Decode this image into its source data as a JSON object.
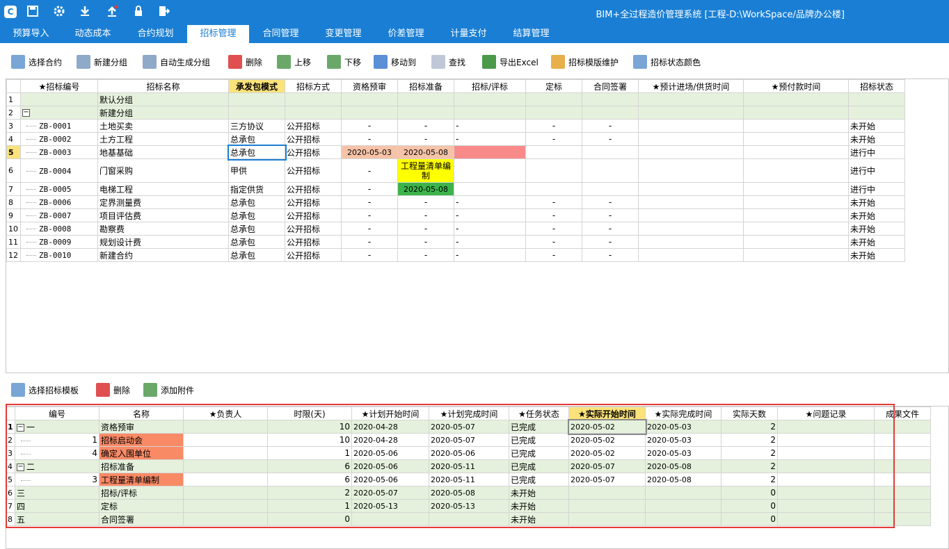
{
  "app": {
    "title": "BIM+全过程造价管理系统 [工程-D:\\WorkSpace/品牌办公楼]"
  },
  "quick_icons": [
    "logo-icon",
    "save-icon",
    "gear-icon",
    "download-icon",
    "upload-icon",
    "lock-icon",
    "exit-icon"
  ],
  "tabs": [
    {
      "label": "预算导入"
    },
    {
      "label": "动态成本"
    },
    {
      "label": "合约规划"
    },
    {
      "label": "招标管理",
      "active": true
    },
    {
      "label": "合同管理"
    },
    {
      "label": "变更管理"
    },
    {
      "label": "价差管理"
    },
    {
      "label": "计量支付"
    },
    {
      "label": "结算管理"
    }
  ],
  "toolbar1": [
    {
      "label": "选择合约"
    },
    {
      "label": "新建分组"
    },
    {
      "label": "自动生成分组"
    },
    {
      "label": "删除"
    },
    {
      "label": "上移"
    },
    {
      "label": "下移"
    },
    {
      "label": "移动到"
    },
    {
      "label": "查找"
    },
    {
      "label": "导出Excel"
    },
    {
      "label": "招标模版维护"
    },
    {
      "label": "招标状态颜色"
    }
  ],
  "grid1": {
    "headers": [
      "★招标编号",
      "招标名称",
      "承发包模式",
      "招标方式",
      "资格预审",
      "招标准备",
      "招标/评标",
      "定标",
      "合同签署",
      "★预计进场/供货时间",
      "★预付款时间",
      "招标状态"
    ],
    "rows": [
      {
        "n": "1",
        "group": true,
        "name": "默认分组"
      },
      {
        "n": "2",
        "group": true,
        "name": "新建分组",
        "collapse": true
      },
      {
        "n": "3",
        "code": "ZB-0001",
        "name": "土地买卖",
        "mode": "三方协议",
        "method": "公开招标",
        "c1": "-",
        "c2": "-",
        "c3": "-",
        "c4": "-",
        "c5": "-",
        "status": "未开始"
      },
      {
        "n": "4",
        "code": "ZB-0002",
        "name": "土方工程",
        "mode": "总承包",
        "method": "公开招标",
        "c1": "-",
        "c2": "-",
        "c3": "-",
        "c4": "-",
        "c5": "-",
        "status": "未开始"
      },
      {
        "n": "5",
        "code": "ZB-0003",
        "name": "地基基础",
        "mode": "总承包",
        "method": "公开招标",
        "c1": "2020-05-03",
        "c2": "2020-05-08",
        "c3": "",
        "c4": "",
        "c5": "",
        "status": "进行中",
        "sel": true
      },
      {
        "n": "6",
        "code": "ZB-0004",
        "name": "门窗采购",
        "mode": "甲供",
        "method": "公开招标",
        "c1": "-",
        "c2": "工程量清单编制",
        "c3": "",
        "c4": "",
        "c5": "",
        "status": "进行中",
        "tall": true
      },
      {
        "n": "7",
        "code": "ZB-0005",
        "name": "电梯工程",
        "mode": "指定供货",
        "method": "公开招标",
        "c1": "-",
        "c2": "2020-05-08",
        "c3": "",
        "c4": "",
        "c5": "",
        "status": "进行中"
      },
      {
        "n": "8",
        "code": "ZB-0006",
        "name": "定界测量费",
        "mode": "总承包",
        "method": "公开招标",
        "c1": "-",
        "c2": "-",
        "c3": "-",
        "c4": "-",
        "c5": "-",
        "status": "未开始"
      },
      {
        "n": "9",
        "code": "ZB-0007",
        "name": "项目评估费",
        "mode": "总承包",
        "method": "公开招标",
        "c1": "-",
        "c2": "-",
        "c3": "-",
        "c4": "-",
        "c5": "-",
        "status": "未开始"
      },
      {
        "n": "10",
        "code": "ZB-0008",
        "name": "勘察费",
        "mode": "总承包",
        "method": "公开招标",
        "c1": "-",
        "c2": "-",
        "c3": "-",
        "c4": "-",
        "c5": "-",
        "status": "未开始"
      },
      {
        "n": "11",
        "code": "ZB-0009",
        "name": "规划设计费",
        "mode": "总承包",
        "method": "公开招标",
        "c1": "-",
        "c2": "-",
        "c3": "-",
        "c4": "-",
        "c5": "-",
        "status": "未开始"
      },
      {
        "n": "12",
        "code": "ZB-0010",
        "name": "新建合约",
        "mode": "总承包",
        "method": "公开招标",
        "c1": "-",
        "c2": "-",
        "c3": "-",
        "c4": "-",
        "c5": "-",
        "status": "未开始"
      }
    ]
  },
  "toolbar2": [
    {
      "label": "选择招标模板"
    },
    {
      "label": "删除"
    },
    {
      "label": "添加附件"
    }
  ],
  "grid2": {
    "headers": [
      "编号",
      "名称",
      "★负责人",
      "时限(天)",
      "★计划开始时间",
      "★计划完成时间",
      "★任务状态",
      "★实际开始时间",
      "★实际完成时间",
      "实际天数",
      "★问题记录",
      "成果文件"
    ],
    "rows": [
      {
        "n": "1",
        "code": "一",
        "name": "资格预审",
        "limit": "10",
        "ps": "2020-04-28",
        "pe": "2020-05-07",
        "st": "已完成",
        "as": "2020-05-02",
        "ae": "2020-05-03",
        "days": "2",
        "group": true,
        "collapse": true
      },
      {
        "n": "2",
        "code": "1",
        "name": "招标启动会",
        "limit": "10",
        "ps": "2020-04-28",
        "pe": "2020-05-07",
        "st": "已完成",
        "as": "2020-05-02",
        "ae": "2020-05-03",
        "days": "2",
        "child": true
      },
      {
        "n": "3",
        "code": "4",
        "name": "确定入围单位",
        "limit": "1",
        "ps": "2020-05-06",
        "pe": "2020-05-06",
        "st": "已完成",
        "as": "2020-05-02",
        "ae": "2020-05-03",
        "days": "2",
        "child": true
      },
      {
        "n": "4",
        "code": "二",
        "name": "招标准备",
        "limit": "6",
        "ps": "2020-05-06",
        "pe": "2020-05-11",
        "st": "已完成",
        "as": "2020-05-07",
        "ae": "2020-05-08",
        "days": "2",
        "group": true,
        "collapse": true
      },
      {
        "n": "5",
        "code": "3",
        "name": "工程量清单编制",
        "limit": "6",
        "ps": "2020-05-06",
        "pe": "2020-05-11",
        "st": "已完成",
        "as": "2020-05-07",
        "ae": "2020-05-08",
        "days": "2",
        "child": true
      },
      {
        "n": "6",
        "code": "三",
        "name": "招标/评标",
        "limit": "2",
        "ps": "2020-05-07",
        "pe": "2020-05-08",
        "st": "未开始",
        "as": "",
        "ae": "",
        "days": "0",
        "group": true
      },
      {
        "n": "7",
        "code": "四",
        "name": "定标",
        "limit": "1",
        "ps": "2020-05-13",
        "pe": "2020-05-13",
        "st": "未开始",
        "as": "",
        "ae": "",
        "days": "0",
        "group": true
      },
      {
        "n": "8",
        "code": "五",
        "name": "合同签署",
        "limit": "0",
        "ps": "",
        "pe": "",
        "st": "未开始",
        "as": "",
        "ae": "",
        "days": "0",
        "group": true
      }
    ]
  },
  "colors": {
    "accent": "#1a7fd4",
    "group_row": "#e5f1dc",
    "highlight_header": "#fce27a",
    "salmon": "#f7c3a8",
    "red": "#f98a8a",
    "yellow": "#ffff00",
    "green": "#3cb44b",
    "orange": "#f98a66",
    "frame": "#e53935"
  }
}
